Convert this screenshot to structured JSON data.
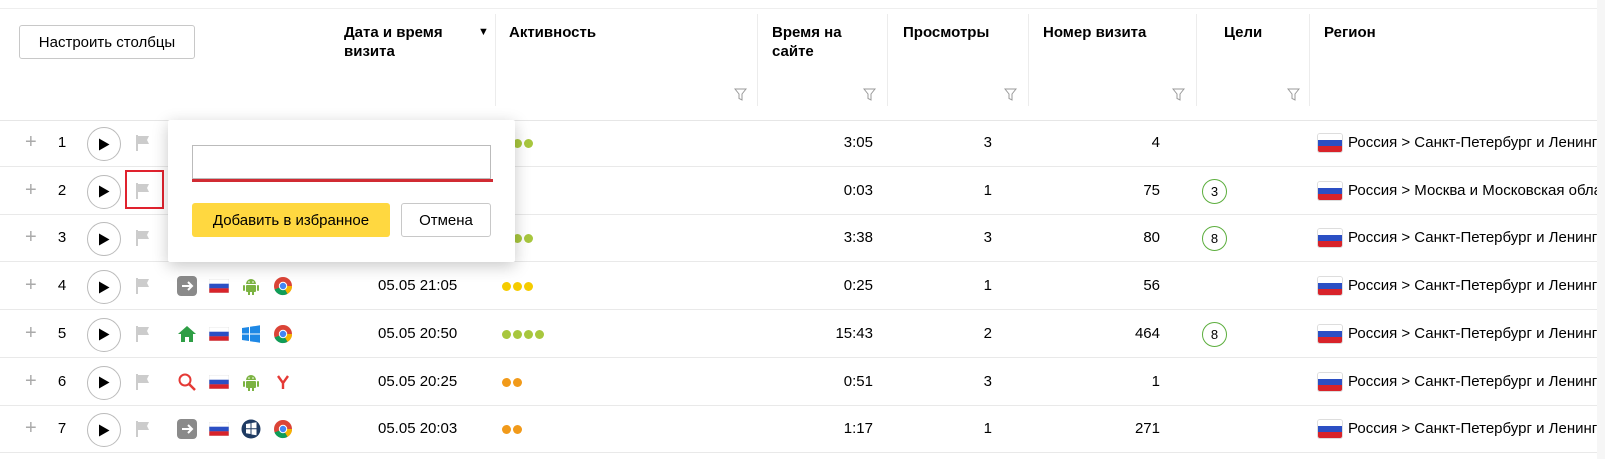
{
  "toolbar": {
    "configure_columns_label": "Настроить столбцы"
  },
  "columns": {
    "datetime": "Дата и время визита",
    "activity": "Активность",
    "time_on_site": "Время на сайте",
    "views": "Просмотры",
    "visit_number": "Номер визита",
    "goals": "Цели",
    "region": "Регион"
  },
  "sort_indicator": "▼",
  "colors": {
    "accent_yellow": "#ffd840",
    "error_red": "#d12b33",
    "goal_green": "#5cae3d",
    "dot_green": "#a8c73e",
    "dot_yellow": "#f5cc00",
    "dot_orange": "#f19a1a"
  },
  "rows": [
    {
      "num": "1",
      "date": "",
      "activity": [
        "green",
        "green",
        "green"
      ],
      "time": "3:05",
      "views": "3",
      "visit": "4",
      "goals": "",
      "region": "Россия > Санкт-Петербург и Ленинградская область"
    },
    {
      "num": "2",
      "date": "",
      "activity": [
        "orange"
      ],
      "time": "0:03",
      "views": "1",
      "visit": "75",
      "goals": "3",
      "region": "Россия > Москва и Московская область"
    },
    {
      "num": "3",
      "date": "",
      "activity": [
        "green",
        "green",
        "green"
      ],
      "time": "3:38",
      "views": "3",
      "visit": "80",
      "goals": "8",
      "region": "Россия > Санкт-Петербург и Ленинградская область"
    },
    {
      "num": "4",
      "date": "05.05 21:05",
      "activity": [
        "yellow",
        "yellow",
        "yellow"
      ],
      "time": "0:25",
      "views": "1",
      "visit": "56",
      "goals": "",
      "region": "Россия > Санкт-Петербург и Ленинградская область",
      "icons": [
        "direct-entry-icon",
        "russia-flag-icon",
        "android-icon",
        "chrome-icon"
      ]
    },
    {
      "num": "5",
      "date": "05.05 20:50",
      "activity": [
        "green",
        "green",
        "green",
        "green"
      ],
      "time": "15:43",
      "views": "2",
      "visit": "464",
      "goals": "8",
      "region": "Россия > Санкт-Петербург и Ленинградская область",
      "icons": [
        "home-icon",
        "russia-flag-icon",
        "windows-icon",
        "chrome-icon"
      ]
    },
    {
      "num": "6",
      "date": "05.05 20:25",
      "activity": [
        "orange",
        "orange"
      ],
      "time": "0:51",
      "views": "3",
      "visit": "1",
      "goals": "",
      "region": "Россия > Санкт-Петербург и Ленинградская область",
      "icons": [
        "search-icon",
        "russia-flag-icon",
        "android-icon",
        "yandex-browser-icon"
      ]
    },
    {
      "num": "7",
      "date": "05.05 20:03",
      "activity": [
        "orange",
        "orange"
      ],
      "time": "1:17",
      "views": "1",
      "visit": "271",
      "goals": "",
      "region": "Россия > Санкт-Петербург и Ленинградская область",
      "icons": [
        "direct-entry-icon",
        "russia-flag-icon",
        "windows7-icon",
        "chrome-icon"
      ]
    }
  ],
  "popup": {
    "input_value": "",
    "add_label": "Добавить в избранное",
    "cancel_label": "Отмена"
  }
}
